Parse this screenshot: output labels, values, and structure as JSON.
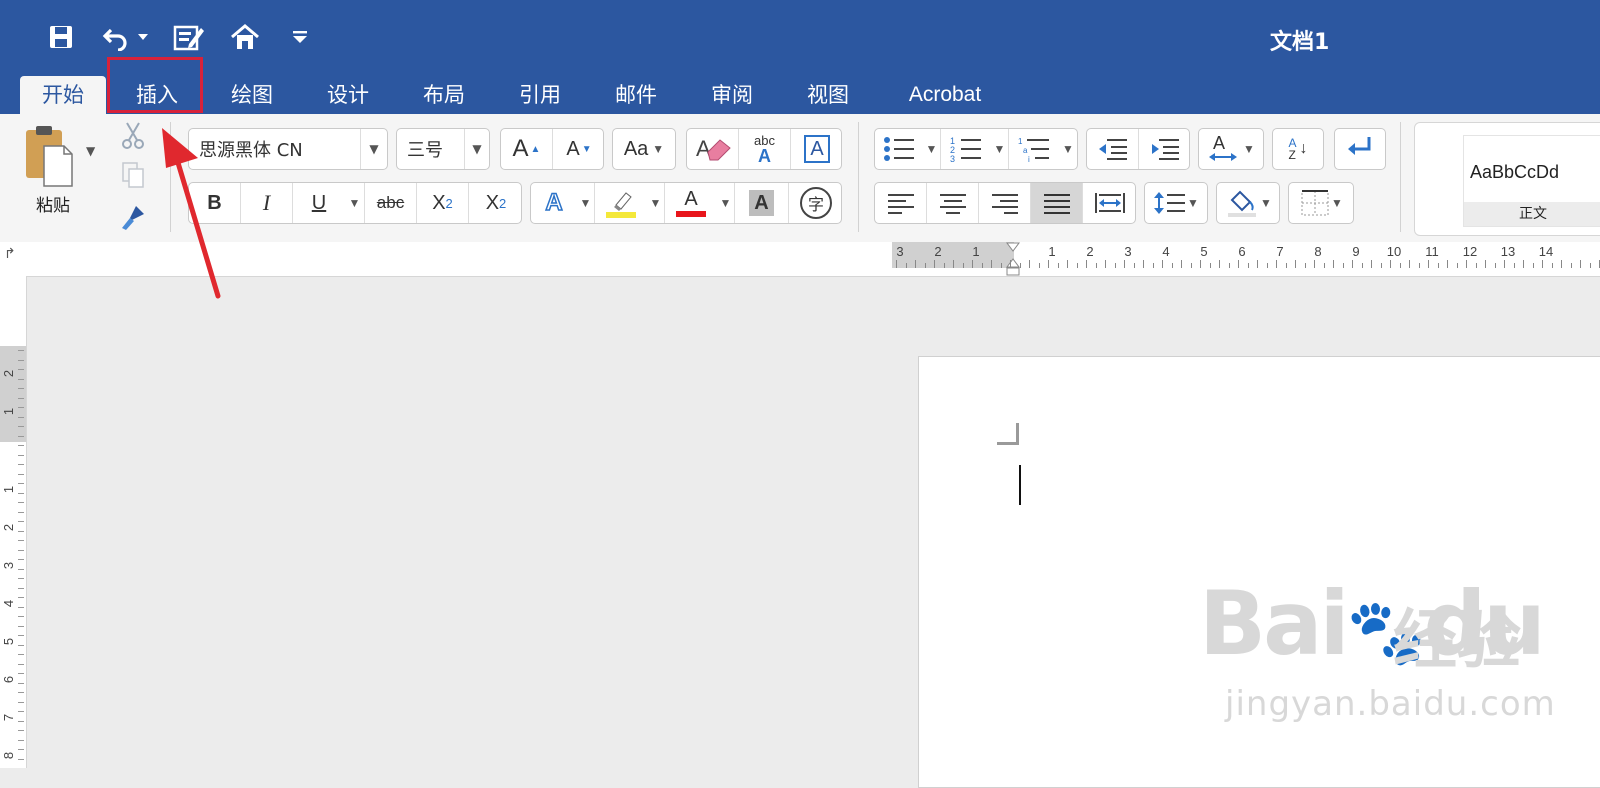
{
  "window": {
    "title": "文档1"
  },
  "quick_access": [
    {
      "name": "save-icon"
    },
    {
      "name": "undo-icon"
    },
    {
      "name": "edit-doc-icon"
    },
    {
      "name": "home-icon"
    },
    {
      "name": "customize-icon"
    }
  ],
  "tabs": [
    {
      "label": "开始",
      "active": true
    },
    {
      "label": "插入"
    },
    {
      "label": "绘图"
    },
    {
      "label": "设计"
    },
    {
      "label": "布局"
    },
    {
      "label": "引用"
    },
    {
      "label": "邮件"
    },
    {
      "label": "审阅"
    },
    {
      "label": "视图"
    },
    {
      "label": "Acrobat"
    }
  ],
  "clipboard": {
    "paste_label": "粘贴"
  },
  "font": {
    "family": "思源黑体 CN",
    "size": "三号",
    "grow": "A",
    "shrink": "A",
    "case": "Aa",
    "abc": "abc",
    "a_box": "A",
    "bold": "B",
    "italic": "I",
    "underline": "U",
    "strike": "abc",
    "subscript": "X",
    "sub_mark": "2",
    "superscript": "X",
    "sup_mark": "2",
    "text_effect": "A",
    "font_color": "A",
    "char_shade": "A",
    "enclose": "字"
  },
  "paragraph": {
    "sort_a": "A",
    "sort_z": "Z"
  },
  "styles": {
    "preview": "AaBbCcDd",
    "name": "正文"
  },
  "ruler": {
    "left_numbers": [
      "3",
      "2",
      "1"
    ],
    "right_numbers": [
      "1",
      "2",
      "3",
      "4",
      "5",
      "6",
      "7",
      "8",
      "9",
      "10",
      "11",
      "12",
      "13",
      "14"
    ],
    "vertical_numbers": [
      "2",
      "1",
      "1",
      "2",
      "3",
      "4",
      "5",
      "6",
      "7",
      "8"
    ]
  },
  "watermark": {
    "brand": "Bai",
    "brand2": "du",
    "cn": "经验",
    "url": "jingyan.baidu.com"
  },
  "colors": {
    "titlebar": "#2c57a0",
    "highlight_box": "#d8223a",
    "arrow": "#e0282e",
    "font_color_bar": "#e8151b",
    "highlight_bar": "#f4e83a"
  }
}
